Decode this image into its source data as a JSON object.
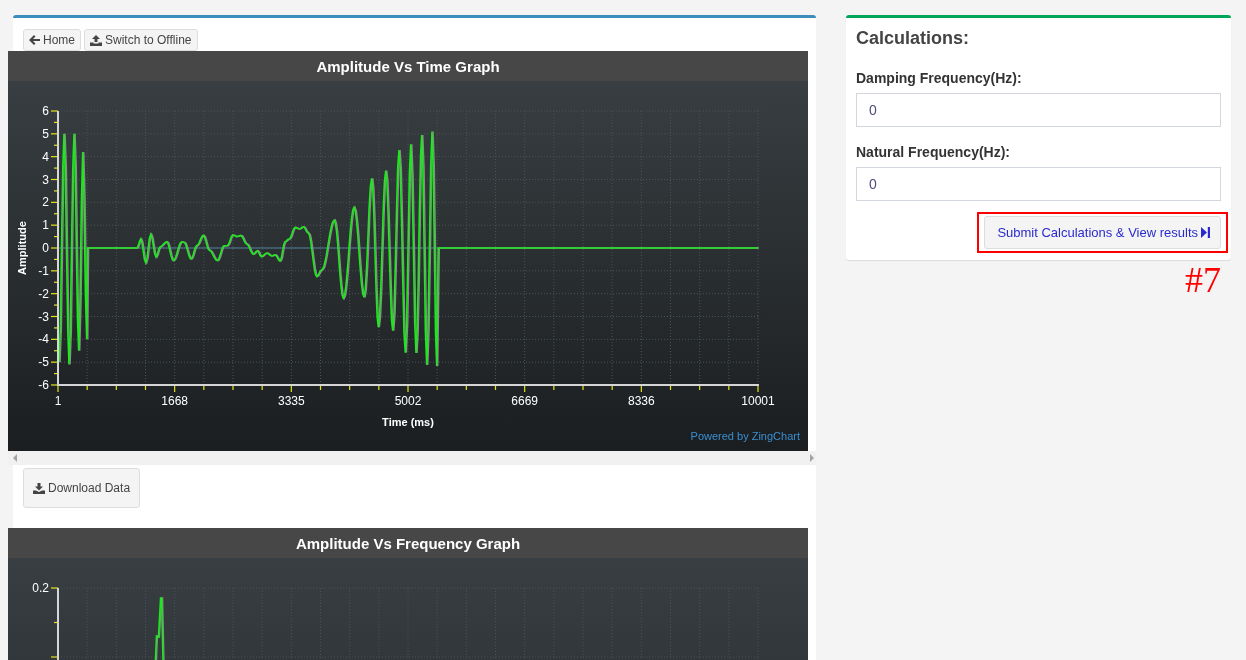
{
  "toolbar": [
    {
      "kind": "home",
      "label": "Home"
    },
    {
      "kind": "offline",
      "label": "Switch to Offline"
    }
  ],
  "time_chart": {
    "title": "Amplitude Vs Time Graph",
    "y_axis_title": "Amplitude",
    "x_axis_title": "Time (ms)",
    "y_tick_labels": [
      "6",
      "5",
      "4",
      "3",
      "2",
      "1",
      "0",
      "-1",
      "-2",
      "-3",
      "-4",
      "-5",
      "-6"
    ],
    "x_tick_labels": [
      "1",
      "1668",
      "3335",
      "5002",
      "6669",
      "8336",
      "10001"
    ],
    "credit": "Powered by ZingChart"
  },
  "download_button": {
    "label": "Download Data"
  },
  "frequency_chart": {
    "title": "Amplitude Vs Frequency Graph",
    "y_tick_labels": [
      "0.2"
    ]
  },
  "calculations": {
    "title": "Calculations:",
    "fields": [
      {
        "label": "Damping Frequency(Hz):",
        "value": "0"
      },
      {
        "label": "Natural Frequency(Hz):",
        "value": "0"
      }
    ],
    "submit_button": {
      "label": "Submit Calculations & View results",
      "highlighted": true,
      "annotation": "#7"
    }
  }
}
